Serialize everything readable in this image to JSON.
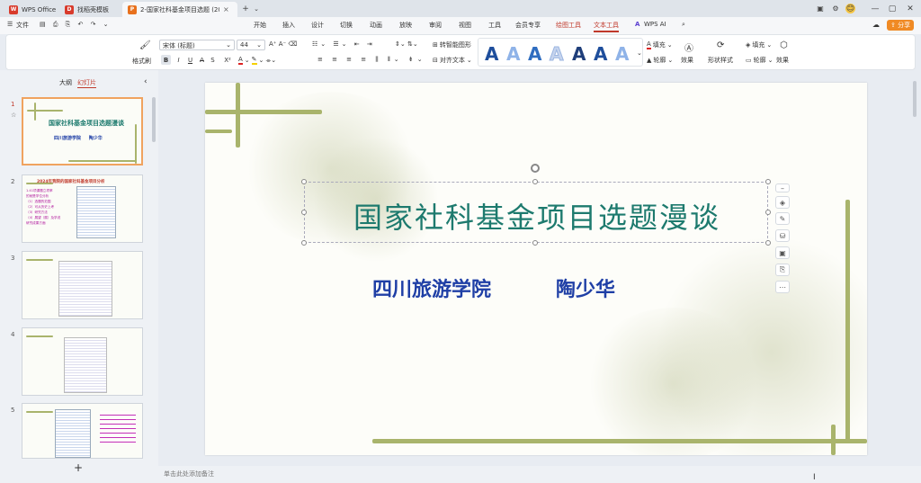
{
  "tabs": [
    {
      "label": "WPS Office",
      "color": "#d83b2c",
      "glyph": "W"
    },
    {
      "label": "找稻壳模板",
      "color": "#d83b2c",
      "glyph": "D"
    },
    {
      "label": "2-国家社科基金项目选题 (20…",
      "color": "#e8711d",
      "glyph": "P"
    }
  ],
  "titlebar": {
    "add_tab": "+",
    "tab_menu": "⌄",
    "close_tab": "×",
    "user_badge": "😊",
    "minimize": "—",
    "restore": "▢",
    "close": "✕",
    "menu": "⌄"
  },
  "menu": {
    "file": "文件",
    "items": [
      "开始",
      "插入",
      "设计",
      "切换",
      "动画",
      "放映",
      "审阅",
      "视图",
      "工具",
      "会员专享"
    ],
    "drawing_tools": "绘图工具",
    "text_tools": "文本工具",
    "wps_ai": "WPS AI",
    "share": "分享"
  },
  "ribbon": {
    "format_painter": "格式刷",
    "font_name": "宋体 (标题)",
    "font_size": "44",
    "bold": "B",
    "italic": "I",
    "underline": "U",
    "strike": "A",
    "shadow": "S",
    "superscript": "X²",
    "convert_smartart": "转智能图形",
    "align_text": "对齐文本",
    "fill": "填充",
    "outline": "轮廓",
    "effect": "效果",
    "shape_style": "形状样式",
    "fill2": "填充",
    "outline2": "轮廓",
    "effect2": "效果",
    "wordart_colors": [
      "#1e4e9c",
      "#8fb3e8",
      "#2f6dc0",
      "#c6d4ee",
      "#1f3e7a",
      "#1e4e9c",
      "#8fb3e8"
    ]
  },
  "sidepanel": {
    "outline_tab": "大纲",
    "slides_tab": "幻灯片",
    "slide_numbers": [
      "1",
      "2",
      "3",
      "4",
      "5"
    ],
    "add_slide": "+",
    "thumb1_title": "国家社科基金项目选题漫谈",
    "thumb1_sub": "四川旅游学院     陶少华",
    "thumb2_title": "2024年我院的国家社科基金项目分析",
    "thumb2_lines": [
      "1.41项课题立项率",
      "的就是学位分析",
      "（1）选题的范围",
      "（2）可从历史上考",
      "（3）研究方法",
      "（4）展望（展）及学说",
      "研究成果方面"
    ]
  },
  "slide": {
    "title": "国家社科基金项目选题漫谈",
    "subtitle_school": "四川旅游学院",
    "subtitle_author": "陶少华",
    "title_color": "#1d7a6e",
    "subtitle_color": "#1f3fa6"
  },
  "notes": {
    "placeholder": "单击此处添加备注"
  }
}
